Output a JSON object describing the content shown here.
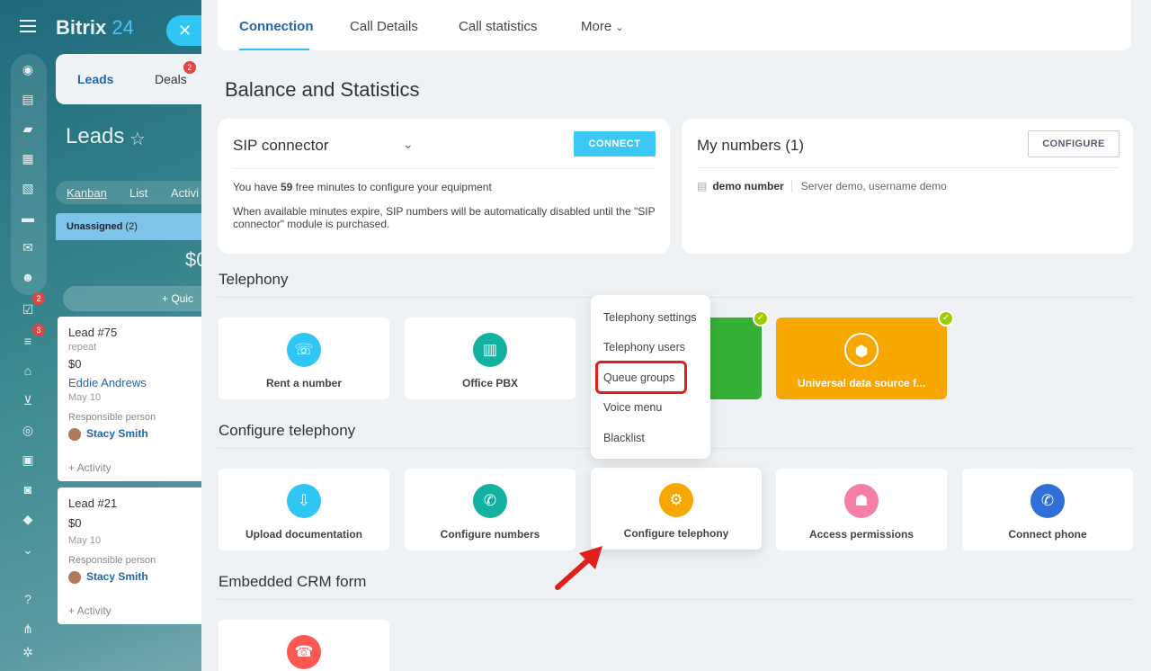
{
  "brand": {
    "name": "Bitrix",
    "num": "24"
  },
  "left_sidebar": {
    "badges": [
      "2",
      "3"
    ]
  },
  "crm": {
    "tabs": [
      {
        "label": "Leads"
      },
      {
        "label": "Deals",
        "badge": "2"
      }
    ],
    "title": "Leads",
    "views": [
      "Kanban",
      "List",
      "Activi"
    ],
    "column": {
      "name": "Unassigned",
      "count": "(2)"
    },
    "sum": "$0",
    "quick": "+ Quic",
    "cards": [
      {
        "name": "Lead #75",
        "sub": "repeat",
        "amount": "$0",
        "client": "Eddie Andrews",
        "date": "May 10",
        "resp_label": "Responsible person",
        "resp": "Stacy Smith",
        "activity": "+ Activity"
      },
      {
        "name": "Lead #21",
        "amount": "$0",
        "date": "May 10",
        "resp_label": "Responsible person",
        "resp": "Stacy Smith",
        "activity": "+ Activity"
      }
    ]
  },
  "slider": {
    "tabs": [
      "Connection",
      "Call Details",
      "Call statistics",
      "More"
    ],
    "heading": "Balance and Statistics",
    "sip": {
      "title": "SIP connector",
      "button": "CONNECT",
      "minutes_pre": "You have",
      "minutes": "59",
      "minutes_post": "free minutes to configure your equipment",
      "notice": "When available minutes expire, SIP numbers will be automatically disabled until the \"SIP connector\" module is purchased."
    },
    "my_numbers": {
      "title": "My numbers (1)",
      "button": "CONFIGURE",
      "number": "demo number",
      "server": "Server demo, username demo"
    },
    "sections": {
      "telephony": "Telephony",
      "configure": "Configure telephony",
      "embedded": "Embedded CRM form"
    },
    "telephony_tiles": [
      "Rent a number",
      "Office PBX",
      "Universal data source f..."
    ],
    "configure_tiles": [
      "Upload documentation",
      "Configure numbers",
      "Configure telephony",
      "Access permissions",
      "Connect phone"
    ],
    "menu": [
      "Telephony settings",
      "Telephony users",
      "Queue groups",
      "Voice menu",
      "Blacklist"
    ]
  },
  "colors": {
    "accent": "#2fc6f6",
    "link": "#2067b0",
    "highlight": "#e0201b",
    "orange": "#f7a700",
    "green": "#34b034"
  }
}
